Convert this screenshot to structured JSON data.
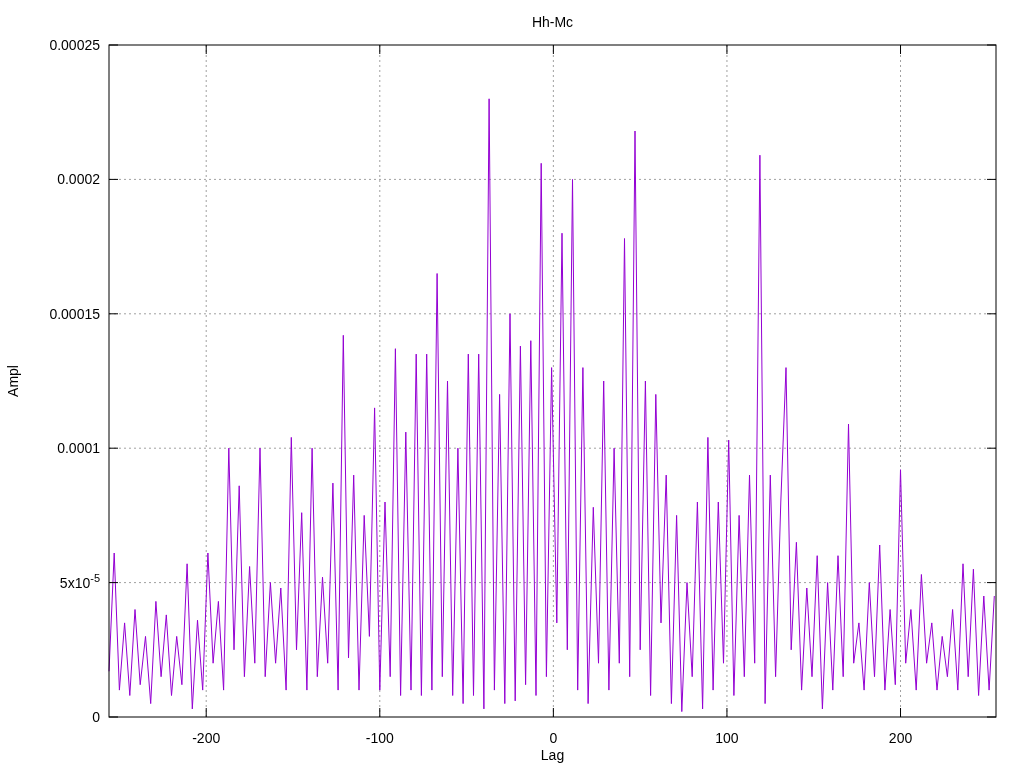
{
  "chart_data": {
    "type": "line",
    "title": "Hh-Mc",
    "xlabel": "Lag",
    "ylabel": "Ampl",
    "xlim": [
      -256,
      255
    ],
    "ylim": [
      0,
      0.00025
    ],
    "xticks": [
      -200,
      -100,
      0,
      100,
      200
    ],
    "yticks": [
      {
        "value": 0,
        "label": "0"
      },
      {
        "value": 5e-05,
        "label": "5x10$^{-5}$"
      },
      {
        "value": 0.0001,
        "label": "0.0001"
      },
      {
        "value": 0.00015,
        "label": "0.00015"
      },
      {
        "value": 0.0002,
        "label": "0.0002"
      },
      {
        "value": 0.00025,
        "label": "0.00025"
      }
    ],
    "x": [
      -256,
      -253,
      -250,
      -247,
      -244,
      -241,
      -238,
      -235,
      -232,
      -229,
      -226,
      -223,
      -220,
      -217,
      -214,
      -211,
      -208,
      -205,
      -202,
      -199,
      -196,
      -193,
      -190,
      -187,
      -184,
      -181,
      -178,
      -175,
      -172,
      -169,
      -166,
      -163,
      -160,
      -157,
      -154,
      -151,
      -148,
      -145,
      -142,
      -139,
      -136,
      -133,
      -130,
      -127,
      -124,
      -121,
      -118,
      -115,
      -112,
      -109,
      -106,
      -103,
      -100,
      -97,
      -94,
      -91,
      -88,
      -85,
      -82,
      -79,
      -76,
      -73,
      -70,
      -67,
      -64,
      -61,
      -58,
      -55,
      -52,
      -49,
      -46,
      -43,
      -40,
      -37,
      -34,
      -31,
      -28,
      -25,
      -22,
      -19,
      -16,
      -13,
      -10,
      -7,
      -4,
      -1,
      2,
      5,
      8,
      11,
      14,
      17,
      20,
      23,
      26,
      29,
      32,
      35,
      38,
      41,
      44,
      47,
      50,
      53,
      56,
      59,
      62,
      65,
      68,
      71,
      74,
      77,
      80,
      83,
      86,
      89,
      92,
      95,
      98,
      101,
      104,
      107,
      110,
      113,
      116,
      119,
      122,
      125,
      128,
      131,
      134,
      137,
      140,
      143,
      146,
      149,
      152,
      155,
      158,
      161,
      164,
      167,
      170,
      173,
      176,
      179,
      182,
      185,
      188,
      191,
      194,
      197,
      200,
      203,
      206,
      209,
      212,
      215,
      218,
      221,
      224,
      227,
      230,
      233,
      236,
      239,
      242,
      245,
      248,
      251,
      254
    ],
    "grid": true,
    "series": [
      {
        "color": "#9400d3",
        "values": [
          1.7e-05,
          6.1e-05,
          1e-05,
          3.5e-05,
          8e-06,
          4e-05,
          1.2e-05,
          3e-05,
          5e-06,
          4.3e-05,
          1.5e-05,
          3.8e-05,
          8e-06,
          3e-05,
          1.2e-05,
          5.7e-05,
          3e-06,
          3.6e-05,
          1e-05,
          6.1e-05,
          2e-05,
          4.3e-05,
          1e-05,
          0.0001,
          2.5e-05,
          8.6e-05,
          1.5e-05,
          5.6e-05,
          2e-05,
          0.0001,
          1.5e-05,
          5e-05,
          2e-05,
          4.8e-05,
          1e-05,
          0.000104,
          2.5e-05,
          7.6e-05,
          1e-05,
          0.0001,
          1.5e-05,
          5.2e-05,
          2e-05,
          8.7e-05,
          1e-05,
          0.000142,
          2.2e-05,
          9e-05,
          1e-05,
          7.5e-05,
          3e-05,
          0.000115,
          1e-05,
          8e-05,
          1.5e-05,
          0.000137,
          8e-06,
          0.000106,
          1e-05,
          0.000135,
          8e-06,
          0.000135,
          1e-05,
          0.000165,
          1.5e-05,
          0.000125,
          8e-06,
          0.0001,
          5e-06,
          0.000135,
          8e-06,
          0.000135,
          3e-06,
          0.00023,
          1e-05,
          0.00012,
          5e-06,
          0.00015,
          6e-06,
          0.000138,
          1.2e-05,
          0.00014,
          8e-06,
          0.000206,
          1.5e-05,
          0.00013,
          3.5e-05,
          0.00018,
          2.5e-05,
          0.0002,
          1e-05,
          0.00013,
          5e-06,
          7.8e-05,
          2e-05,
          0.000125,
          1e-05,
          0.0001,
          2e-05,
          0.000178,
          1.5e-05,
          0.000218,
          2.5e-05,
          0.000125,
          8e-06,
          0.00012,
          3.5e-05,
          9e-05,
          5e-06,
          7.5e-05,
          2e-06,
          5e-05,
          1.5e-05,
          8e-05,
          3e-06,
          0.000104,
          1e-05,
          8e-05,
          2e-05,
          0.000103,
          8e-06,
          7.5e-05,
          1.5e-05,
          9e-05,
          2e-05,
          0.000209,
          5e-06,
          9e-05,
          1.5e-05,
          8e-05,
          0.00013,
          2.5e-05,
          6.5e-05,
          1e-05,
          4.8e-05,
          1.5e-05,
          6e-05,
          3e-06,
          5e-05,
          1e-05,
          6e-05,
          1.5e-05,
          0.000109,
          2e-05,
          3.5e-05,
          1e-05,
          5e-05,
          1.5e-05,
          6.4e-05,
          1e-05,
          4e-05,
          1.2e-05,
          9.2e-05,
          2e-05,
          4e-05,
          1e-05,
          5.3e-05,
          2e-05,
          3.5e-05,
          1e-05,
          3e-05,
          1.5e-05,
          4e-05,
          1e-05,
          5.7e-05,
          1.5e-05,
          5.5e-05,
          8e-06,
          4.5e-05,
          1e-05,
          4.5e-05
        ]
      }
    ]
  }
}
